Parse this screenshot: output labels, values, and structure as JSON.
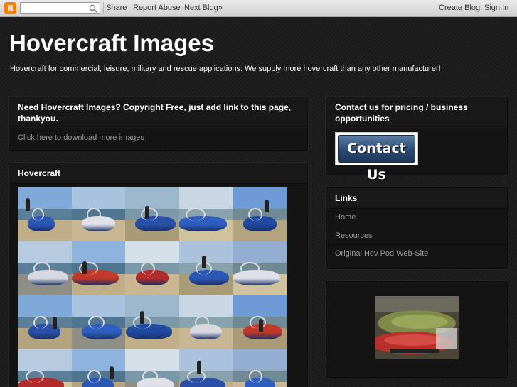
{
  "navbar": {
    "logo_icon": "blogger-logo-icon",
    "search_placeholder": "",
    "links": [
      "Share",
      "Report Abuse",
      "Next Blog»"
    ],
    "right_links": [
      "Create Blog",
      "Sign In"
    ]
  },
  "header": {
    "title": "Hovercraft Images",
    "description": "Hovercraft for commercial, leisure, military and rescue applications. We supply more hovercraft than any other manufacturer!"
  },
  "main": {
    "notice": {
      "title": "Need Hovercraft Images? Copyright Free, just add link to this page, thankyou.",
      "link": "Click here to download more images"
    },
    "gallery": {
      "title": "Hovercraft",
      "tile_count": 20
    }
  },
  "sidebar": {
    "contact": {
      "title": "Contact us for pricing / business opportunities",
      "button_label": "Contact Us"
    },
    "links": {
      "title": "Links",
      "items": [
        "Home",
        "Resources",
        "Original Hov Pod Web-Site"
      ]
    }
  },
  "colors": {
    "background": "#1b1b1b",
    "widget": "#141414",
    "navbar": "#dcdcdc",
    "logo": "#f57d00",
    "contact_button": "#2c4a72"
  }
}
